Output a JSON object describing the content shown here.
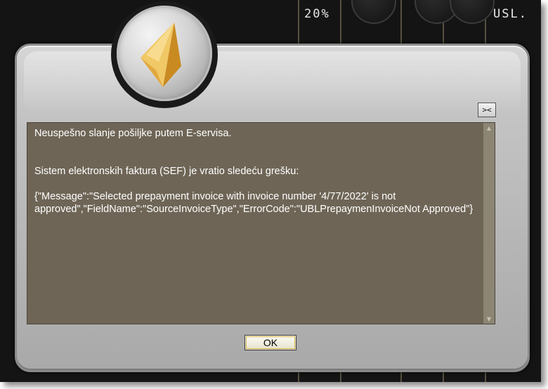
{
  "background": {
    "percent_text": "20%",
    "usl_text": "USL."
  },
  "dialog": {
    "toggle_label": "><",
    "message": {
      "line1": "Neuspešno slanje pošiljke putem E-servisa.",
      "line2": "Sistem elektronskih faktura (SEF) je vratio sledeću grešku:",
      "line3": "{\"Message\":\"Selected prepayment invoice with invoice number '4/77/2022' is not approved\",\"FieldName\":\"SourceInvoiceType\",\"ErrorCode\":\"UBLPrepaymenInvoiceNot Approved\"}"
    },
    "ok_label": "OK"
  },
  "icons": {
    "emblem": "gold-pyramid-icon",
    "scroll_up": "scroll-up-arrow-icon",
    "scroll_down": "scroll-down-arrow-icon"
  },
  "colors": {
    "message_bg": "#6e6556",
    "panel": "#c4c4c4",
    "ok_border": "#d4b24a"
  }
}
